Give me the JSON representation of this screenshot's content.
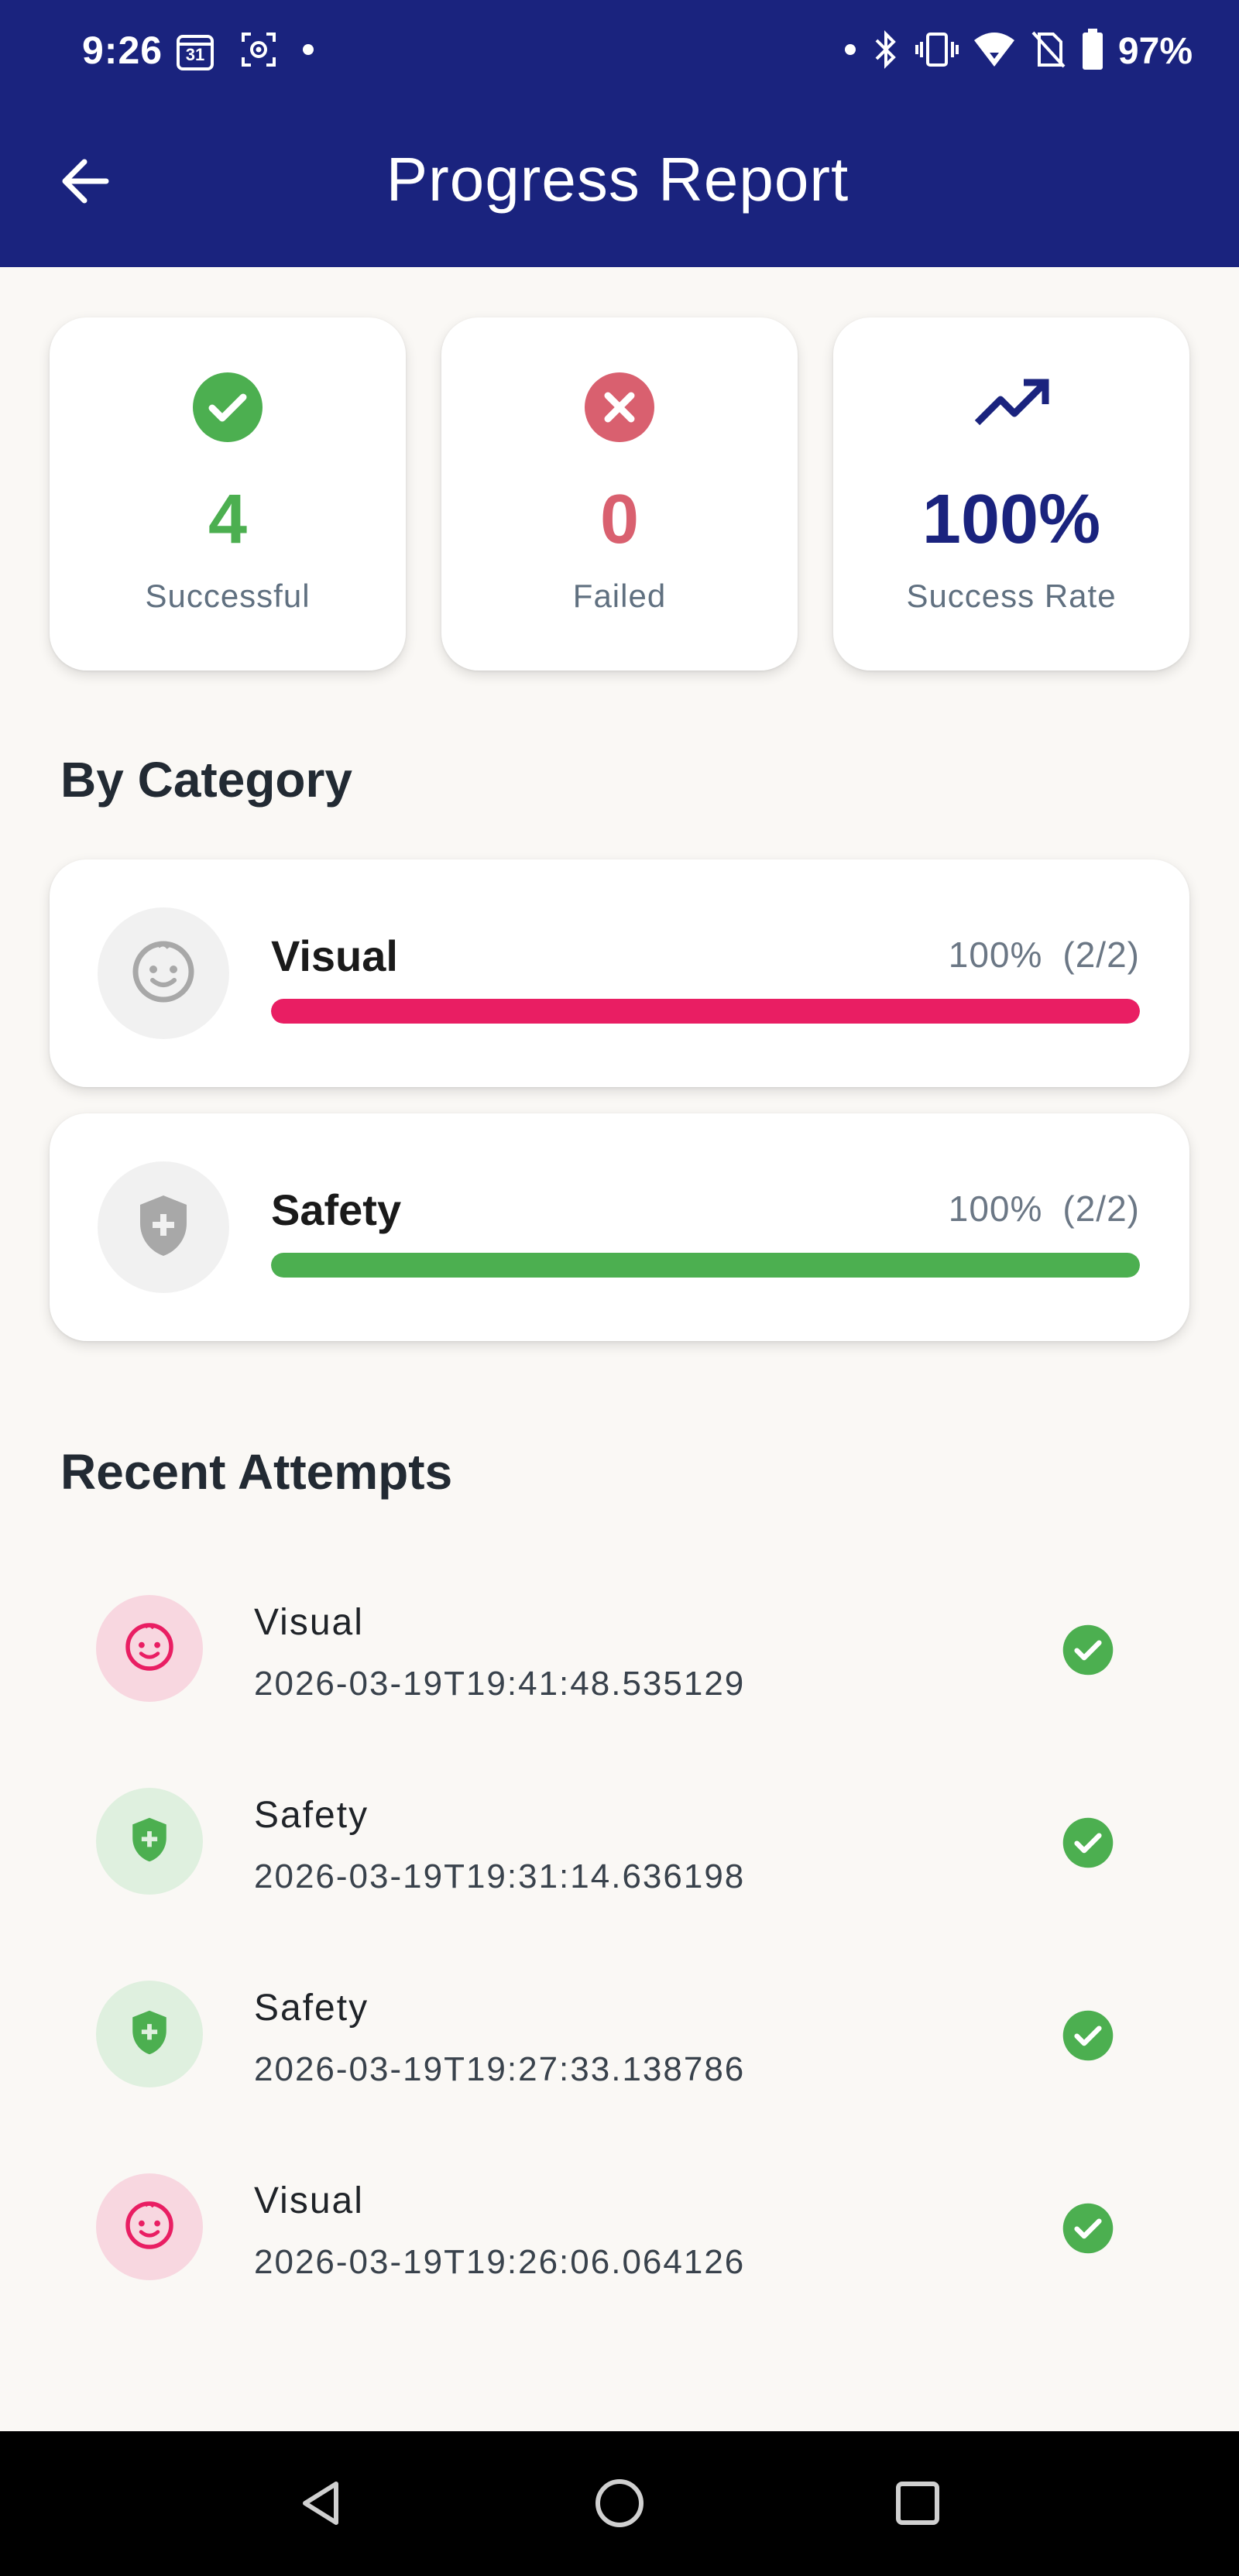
{
  "status_bar": {
    "time": "9:26",
    "calendar_day": "31",
    "battery": "97%"
  },
  "app_bar": {
    "title": "Progress Report",
    "back_icon": "arrow-left-icon"
  },
  "stats": [
    {
      "icon": "check-circle-icon",
      "value": "4",
      "label": "Successful",
      "color": "#4caf50"
    },
    {
      "icon": "x-circle-icon",
      "value": "0",
      "label": "Failed",
      "color": "#d9606f"
    },
    {
      "icon": "trending-up-icon",
      "value": "100%",
      "label": "Success Rate",
      "color": "#1a237e"
    }
  ],
  "by_category": {
    "title": "By Category",
    "items": [
      {
        "name": "Visual",
        "percent": "100%",
        "ratio": "(2/2)",
        "progress": 1.0,
        "color": "#e91e63",
        "icon": "baby-face-icon"
      },
      {
        "name": "Safety",
        "percent": "100%",
        "ratio": "(2/2)",
        "progress": 1.0,
        "color": "#4caf50",
        "icon": "shield-plus-icon"
      }
    ]
  },
  "recent_attempts": {
    "title": "Recent Attempts",
    "items": [
      {
        "name": "Visual",
        "timestamp": "2026-03-19T19:41:48.535129",
        "icon": "baby-face-icon",
        "result": "check-circle-icon"
      },
      {
        "name": "Safety",
        "timestamp": "2026-03-19T19:31:14.636198",
        "icon": "shield-plus-icon",
        "result": "check-circle-icon"
      },
      {
        "name": "Safety",
        "timestamp": "2026-03-19T19:27:33.138786",
        "icon": "shield-plus-icon",
        "result": "check-circle-icon"
      },
      {
        "name": "Visual",
        "timestamp": "2026-03-19T19:26:06.064126",
        "icon": "baby-face-icon",
        "result": "check-circle-icon"
      }
    ]
  },
  "colors": {
    "app_bar": "#1a237e",
    "background": "#faf8f5",
    "success": "#4caf50",
    "failed": "#d9606f",
    "visual": "#e91e63"
  }
}
